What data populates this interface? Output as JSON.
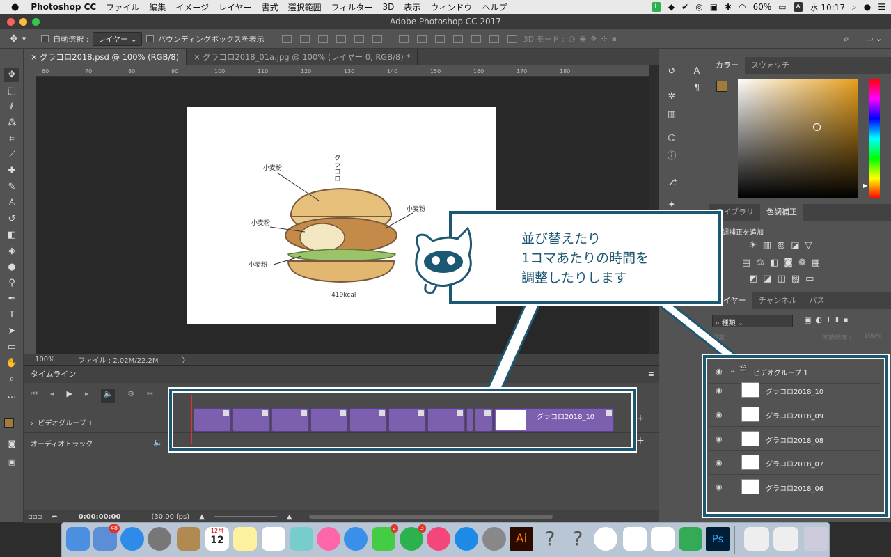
{
  "menubar": {
    "apple": "",
    "app": "Photoshop CC",
    "items": [
      "ファイル",
      "編集",
      "イメージ",
      "レイヤー",
      "書式",
      "選択範囲",
      "フィルター",
      "3D",
      "表示",
      "ウィンドウ",
      "ヘルプ"
    ],
    "battery": "60%",
    "input_source": "A",
    "clock": "水 10:17"
  },
  "window": {
    "title": "Adobe Photoshop CC 2017"
  },
  "options": {
    "auto_select_label": "自動選択 :",
    "auto_select_value": "レイヤー",
    "bbox_label": "バウンディングボックスを表示",
    "mode3d_label": "3D モード :"
  },
  "doc_tabs": [
    {
      "label": "グラコロ2018.psd @ 100% (RGB/8)"
    },
    {
      "label": "グラコロ2018_01a.jpg @ 100% (レイヤー 0, RGB/8) *"
    }
  ],
  "ruler": {
    "marks": [
      "60",
      "70",
      "80",
      "90",
      "100",
      "110",
      "120",
      "130",
      "140",
      "150",
      "160",
      "170",
      "180"
    ]
  },
  "artwork": {
    "title": "グラコロ",
    "labels": [
      "小麦粉",
      "小麦粉",
      "小麦粉",
      "小麦粉"
    ],
    "kcal": "419kcal"
  },
  "status": {
    "zoom": "100%",
    "file": "ファイル : 2.02M/22.2M"
  },
  "timeline": {
    "title": "タイムライン",
    "track_video": "ビデオグループ 1",
    "track_audio": "オーディオトラック",
    "clip_label": "グラコロ2018_10",
    "timecode": "0:00:00:00",
    "fps": "(30.00 fps)"
  },
  "panels": {
    "color_tabs": [
      "カラー",
      "スウォッチ"
    ],
    "adjust_tabs": [
      "ライブラリ",
      "色調補正"
    ],
    "adjust_hint": "色調補正を追加",
    "layers_tabs": [
      "レイヤー",
      "チャンネル",
      "パス"
    ],
    "filter": "種類",
    "blend": "通常",
    "opacity_label": "不透明度 :",
    "opacity": "100%",
    "group_name": "ビデオグループ 1",
    "layers": [
      "グラコロ2018_10",
      "グラコロ2018_09",
      "グラコロ2018_08",
      "グラコロ2018_07",
      "グラコロ2018_06"
    ]
  },
  "callout": {
    "lines": [
      "並び替えたり",
      "1コマあたりの時間を",
      "調整したりします"
    ]
  },
  "colors": {
    "accent": "#1d5872",
    "clip": "#7d5fb0",
    "fg_swatch": "#a07b3a"
  },
  "dock": {
    "mail_badge": "48",
    "facetime_badge": "2",
    "line_badge": "3",
    "calendar_month": "12月",
    "calendar_day": "12",
    "ai_label": "Ai",
    "ps_label": "Ps"
  }
}
